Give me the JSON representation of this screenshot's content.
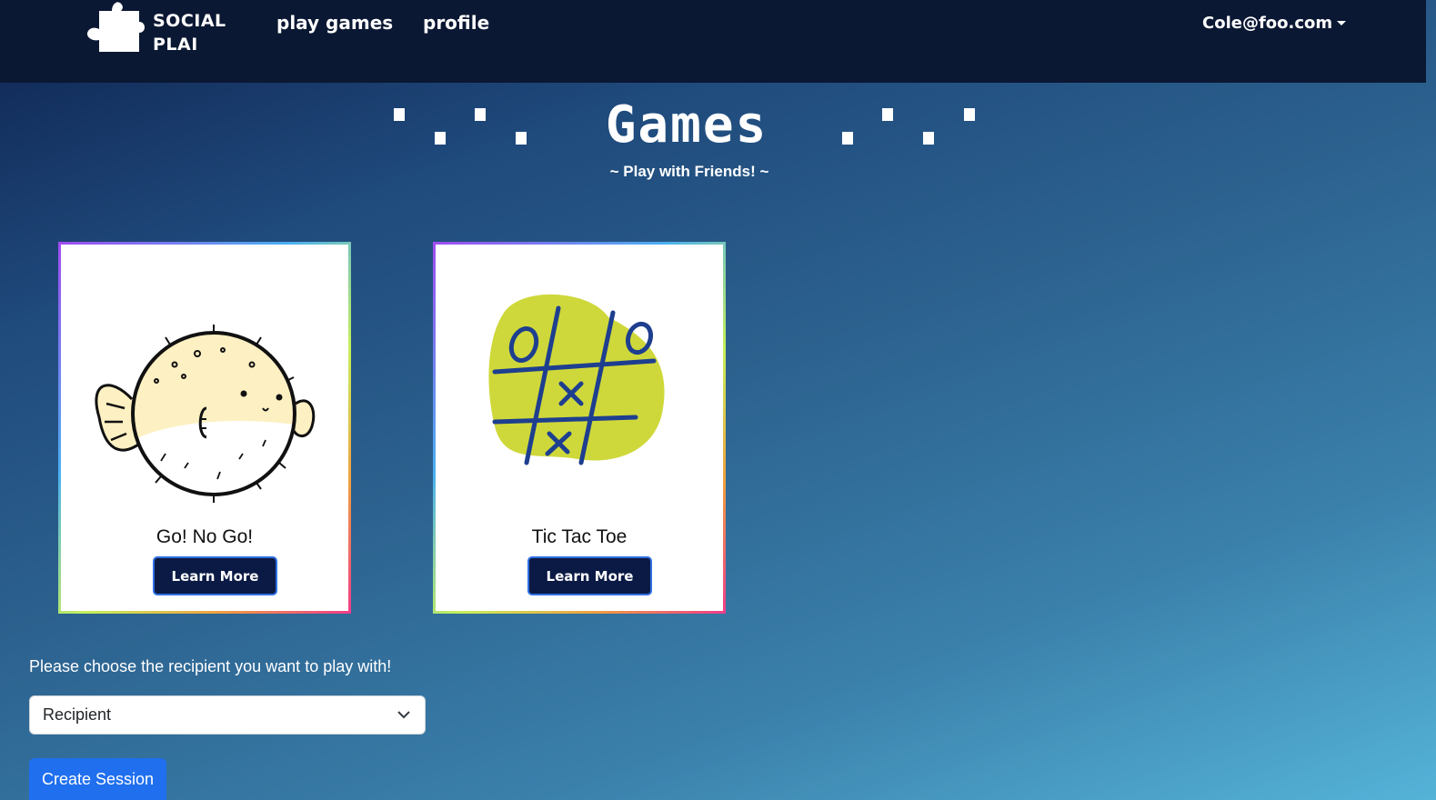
{
  "nav": {
    "brand_line1": "SOCIAL",
    "brand_line2": "PLAI",
    "play_games": "play games",
    "profile": "profile",
    "user_email": "Cole@foo.com"
  },
  "hero": {
    "title": "Games",
    "subtitle": "~ Play with Friends! ~"
  },
  "games": [
    {
      "title": "Go! No Go!",
      "button": "Learn More",
      "icon": "pufferfish-icon"
    },
    {
      "title": "Tic Tac Toe",
      "button": "Learn More",
      "icon": "tic-tac-toe-icon"
    }
  ],
  "session": {
    "prompt": "Please choose the recipient you want to play with!",
    "recipient_selected": "Recipient",
    "create_button": "Create Session"
  },
  "colors": {
    "navbar": "#0b1833",
    "button_dark": "#0b1a45",
    "button_primary": "#1f6fef",
    "tictactoe_blob": "#cfd83a",
    "tictactoe_lines": "#1e3f8f",
    "fish_body": "#fdf0c2"
  }
}
